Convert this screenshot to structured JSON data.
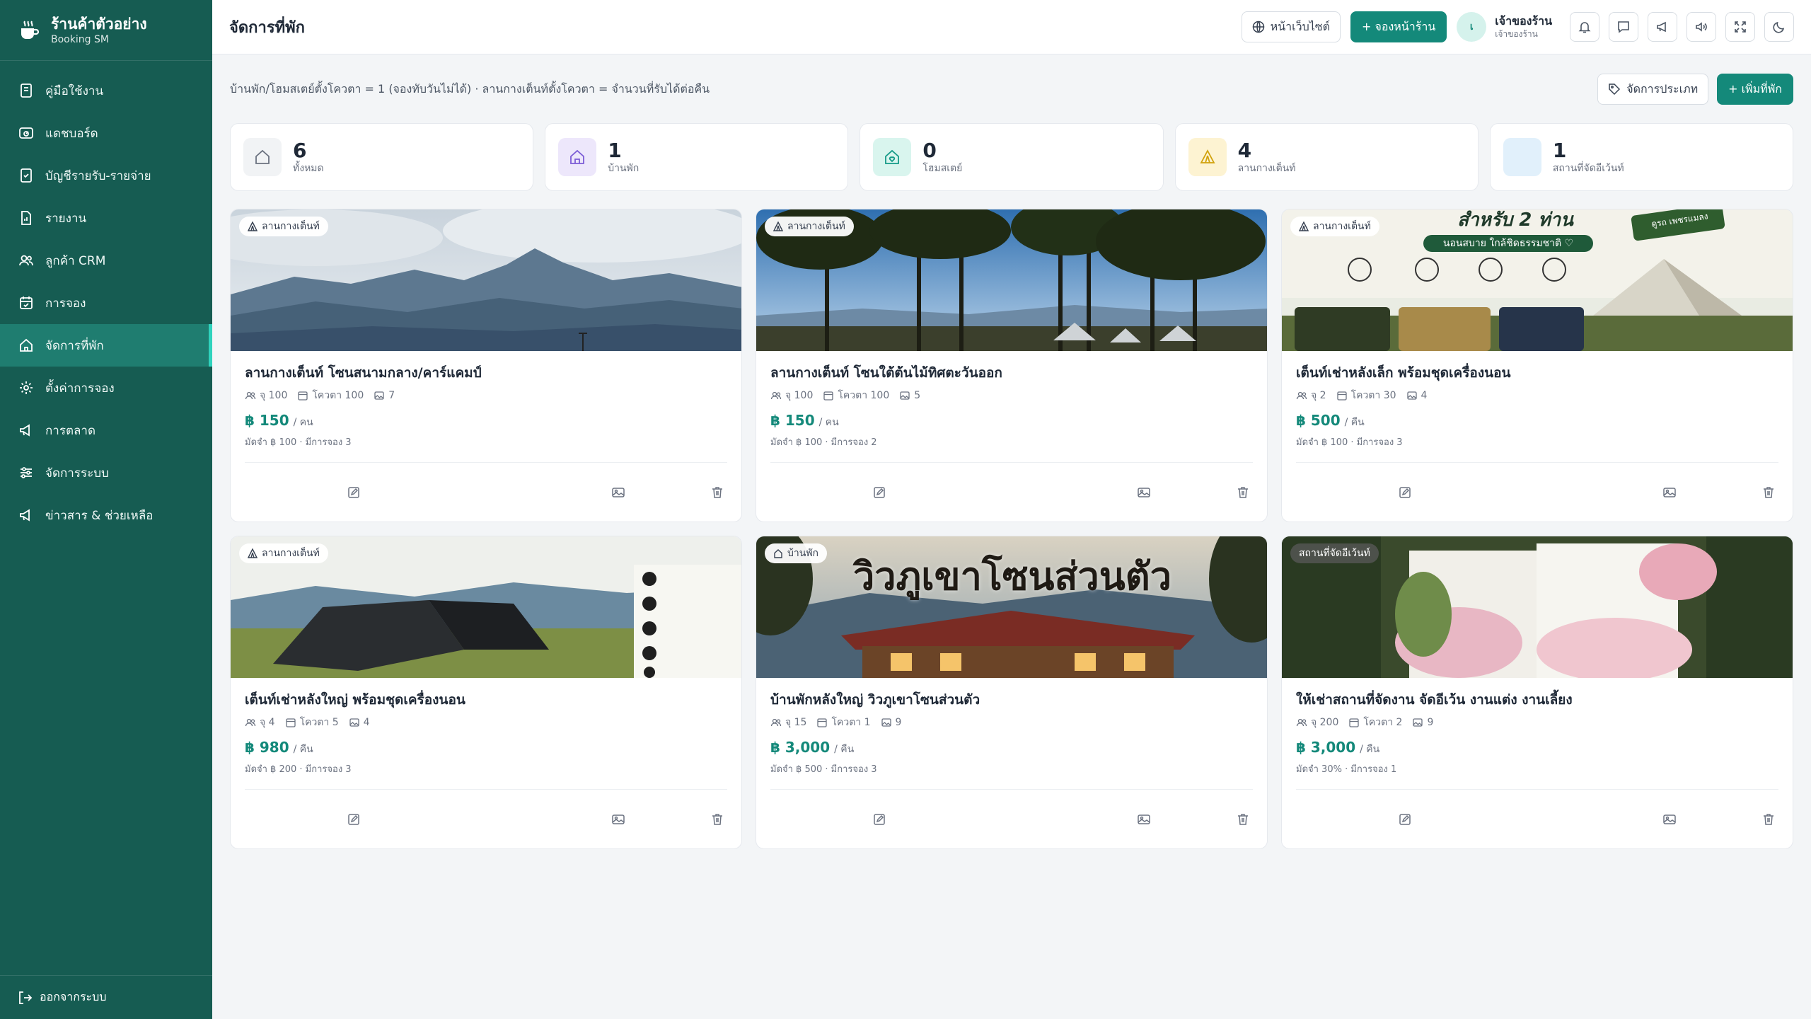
{
  "brand": {
    "title": "ร้านค้าตัวอย่าง",
    "subtitle": "Booking SM"
  },
  "sidebar": {
    "items": [
      {
        "label": "คู่มือใช้งาน",
        "icon": "book-icon"
      },
      {
        "label": "แดชบอร์ด",
        "icon": "dashboard-icon"
      },
      {
        "label": "บัญชีรายรับ-รายจ่าย",
        "icon": "ledger-icon"
      },
      {
        "label": "รายงาน",
        "icon": "report-icon"
      },
      {
        "label": "ลูกค้า CRM",
        "icon": "users-icon"
      },
      {
        "label": "การจอง",
        "icon": "calendar-icon"
      },
      {
        "label": "จัดการที่พัก",
        "icon": "home-icon",
        "active": true
      },
      {
        "label": "ตั้งค่าการจอง",
        "icon": "settings-icon"
      },
      {
        "label": "การตลาด",
        "icon": "megaphone-icon"
      },
      {
        "label": "จัดการระบบ",
        "icon": "sliders-icon"
      },
      {
        "label": "ข่าวสาร & ช่วยเหลือ",
        "icon": "megaphone-icon"
      }
    ],
    "logout": "ออกจากระบบ"
  },
  "header": {
    "title": "จัดการที่พัก",
    "website_label": "หน้าเว็บไซต์",
    "booking_label": "+ จองหน้าร้าน",
    "user_initial": "เ",
    "user_name": "เจ้าของร้าน",
    "user_role": "เจ้าของร้าน"
  },
  "main": {
    "info": "บ้านพัก/โฮมสเตย์ตั้งโควตา = 1 (จองทับวันไม่ได้) · ลานกางเต็นท์ตั้งโควตา = จำนวนที่รับได้ต่อคืน",
    "manage_types_label": "จัดการประเภท",
    "add_label": "+ เพิ่มที่พัก",
    "stats": [
      {
        "value": "6",
        "label": "ทั้งหมด",
        "bg": "#f1f3f5",
        "icon": "home-outline-icon"
      },
      {
        "value": "1",
        "label": "บ้านพัก",
        "bg": "#ede7fb",
        "icon": "house-icon"
      },
      {
        "value": "0",
        "label": "โฮมสเตย์",
        "bg": "#d9f5ee",
        "icon": "homestay-icon"
      },
      {
        "value": "4",
        "label": "ลานกางเต็นท์",
        "bg": "#fdf3d2",
        "icon": "tent-icon"
      },
      {
        "value": "1",
        "label": "สถานที่จัดอีเว้นท์",
        "bg": "#e1f0fb",
        "icon": "event-icon"
      }
    ],
    "cards": [
      {
        "badge": "ลานกางเต็นท์",
        "title": "ลานกางเต็นท์ โซนสนามกลาง/คาร์แคมป์",
        "capacity": "จุ 100",
        "quota": "โควตา 100",
        "images": "7",
        "price": "฿ 150",
        "unit": "/ คน",
        "deposit": "มัดจำ ฿ 100 · มีการจอง 3"
      },
      {
        "badge": "ลานกางเต็นท์",
        "title": "ลานกางเต็นท์ โซนใต้ต้นไม้ทิศตะวันออก",
        "capacity": "จุ 100",
        "quota": "โควตา 100",
        "images": "5",
        "price": "฿ 150",
        "unit": "/ คน",
        "deposit": "มัดจำ ฿ 100 · มีการจอง 2"
      },
      {
        "badge": "ลานกางเต็นท์",
        "title": "เต็นท์เช่าหลังเล็ก พร้อมชุดเครื่องนอน",
        "capacity": "จุ 2",
        "quota": "โควตา 30",
        "images": "4",
        "price": "฿ 500",
        "unit": "/ คืน",
        "deposit": "มัดจำ ฿ 100 · มีการจอง 3"
      },
      {
        "badge": "ลานกางเต็นท์",
        "title": "เต็นท์เช่าหลังใหญ่ พร้อมชุดเครื่องนอน",
        "capacity": "จุ 4",
        "quota": "โควตา 5",
        "images": "4",
        "price": "฿ 980",
        "unit": "/ คืน",
        "deposit": "มัดจำ ฿ 200 · มีการจอง 3"
      },
      {
        "badge": "บ้านพัก",
        "title": "บ้านพักหลังใหญ่ วิวภูเขาโซนส่วนตัว",
        "capacity": "จุ 15",
        "quota": "โควตา 1",
        "images": "9",
        "price": "฿ 3,000",
        "unit": "/ คืน",
        "deposit": "มัดจำ ฿ 500 · มีการจอง 3"
      },
      {
        "badge": "สถานที่จัดอีเว้นท์",
        "title": "ให้เช่าสถานที่จัดงาน จัดอีเว้น งานแต่ง งานเลี้ยง",
        "capacity": "จุ 200",
        "quota": "โควตา 2",
        "images": "9",
        "price": "฿ 3,000",
        "unit": "/ คืน",
        "deposit": "มัดจำ 30% · มีการจอง 1"
      }
    ],
    "card_images": {
      "c3_line1": "สำหรับ 2 ท่าน",
      "c3_line2": "นอนสบาย ใกล้ชิดธรรมชาติ ♡",
      "c3_tag": "ดูรถ เพชรแมลง",
      "c5_text": "วิวภูเขาโซนส่วนตัว"
    }
  },
  "colors": {
    "sidebar": "#165c52",
    "active": "#1f7d70",
    "primary": "#14897a"
  }
}
